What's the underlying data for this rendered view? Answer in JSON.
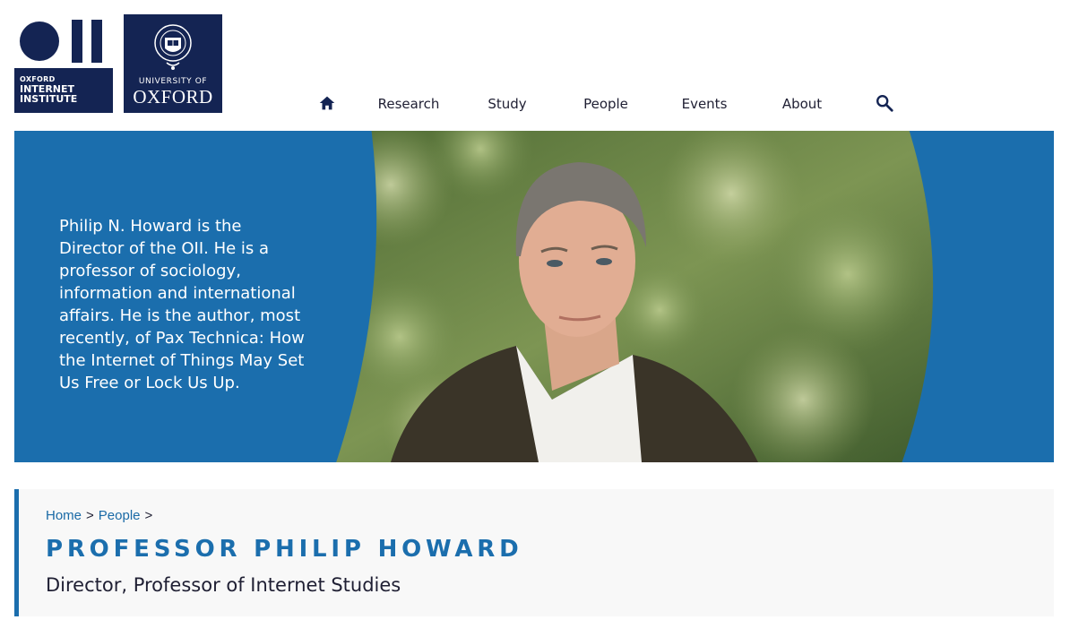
{
  "logos": {
    "oii": {
      "line1": "OXFORD",
      "line2": "INTERNET",
      "line3": "INSTITUTE"
    },
    "oxford": {
      "university": "UNIVERSITY OF",
      "name": "OXFORD"
    }
  },
  "nav": {
    "home_icon": "home-icon",
    "items": [
      {
        "label": "Research"
      },
      {
        "label": "Study"
      },
      {
        "label": "People"
      },
      {
        "label": "Events"
      },
      {
        "label": "About"
      }
    ],
    "search_icon": "search-icon"
  },
  "hero": {
    "bio": "Philip N. Howard is the Director of the OII. He is a professor of sociology, information and international affairs. He is the author, most recently, of Pax Technica: How the Internet of Things May Set Us Free or Lock Us Up."
  },
  "breadcrumb": {
    "items": [
      {
        "label": "Home"
      },
      {
        "label": "People"
      }
    ],
    "separator": ">"
  },
  "profile": {
    "name": "PROFESSOR PHILIP HOWARD",
    "title": "Director, Professor of Internet Studies"
  },
  "colors": {
    "navy": "#142453",
    "accent_blue": "#1b6ead",
    "text_dark": "#1f1f33"
  }
}
